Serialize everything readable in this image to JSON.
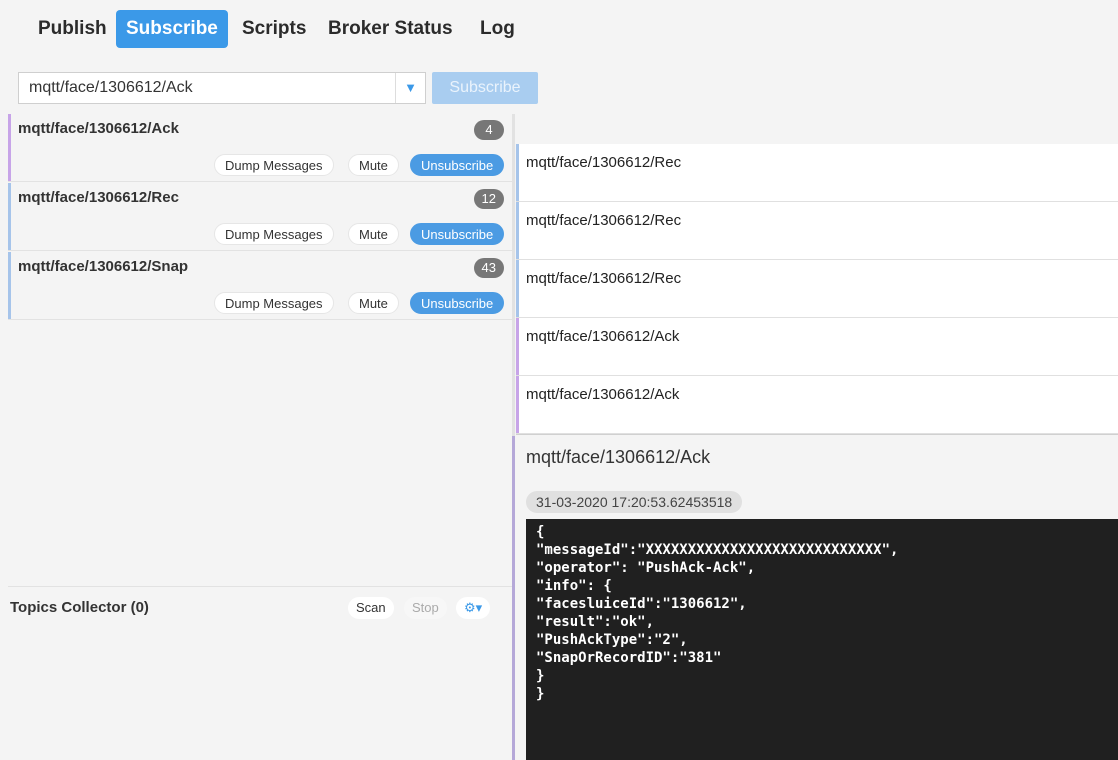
{
  "nav": {
    "tabs": [
      "Publish",
      "Subscribe",
      "Scripts",
      "Broker Status",
      "Log"
    ]
  },
  "subscribe_bar": {
    "topic": "mqtt/face/1306612/Ack",
    "button": "Subscribe"
  },
  "subscriptions": [
    {
      "topic": "mqtt/face/1306612/Ack",
      "count": "4",
      "color": "#c7a4e8"
    },
    {
      "topic": "mqtt/face/1306612/Rec",
      "count": "12",
      "color": "#a6c4ea"
    },
    {
      "topic": "mqtt/face/1306612/Snap",
      "count": "43",
      "color": "#a6c4ea"
    }
  ],
  "subscription_actions": {
    "dump": "Dump Messages",
    "mute": "Mute",
    "unsubscribe": "Unsubscribe"
  },
  "topics_collector": {
    "title": "Topics Collector (0)",
    "scan": "Scan",
    "stop": "Stop",
    "options": "⚙▾"
  },
  "messages": [
    {
      "topic": "mqtt/face/1306612/Rec"
    },
    {
      "topic": "mqtt/face/1306612/Rec"
    },
    {
      "topic": "mqtt/face/1306612/Rec"
    },
    {
      "topic": "mqtt/face/1306612/Ack"
    },
    {
      "topic": "mqtt/face/1306612/Ack"
    }
  ],
  "detail": {
    "topic": "mqtt/face/1306612/Ack",
    "timestamp": "31-03-2020  17:20:53.62453518",
    "payload": "{\n\"messageId\":\"XXXXXXXXXXXXXXXXXXXXXXXXXXXX\",\n\"operator\": \"PushAck-Ack\",\n\"info\": {\n\"facesluiceId\":\"1306612\",\n\"result\":\"ok\",\n\"PushAckType\":\"2\",\n\"SnapOrRecordID\":\"381\"\n}\n}"
  },
  "colors": {
    "accent": "#3b99e8",
    "accent_disabled": "#a9cdf0",
    "ack_bar": "#c7a4e8",
    "rec_bar": "#a6c4ea"
  }
}
